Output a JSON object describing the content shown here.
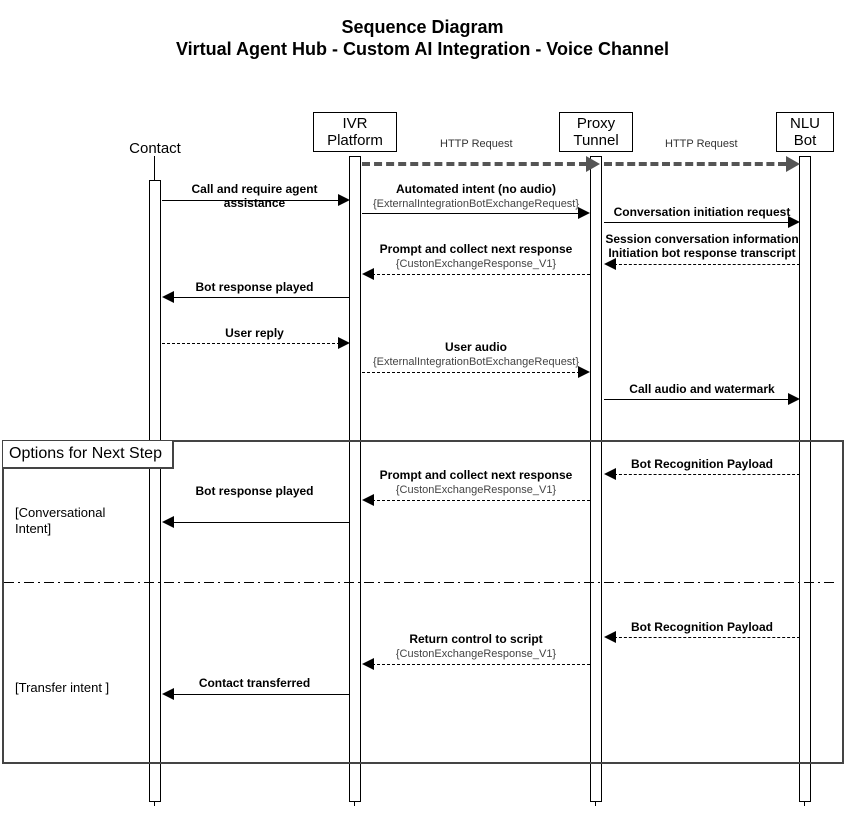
{
  "title_line1": "Sequence Diagram",
  "title_line2": "Virtual Agent Hub -  Custom AI Integration - Voice Channel",
  "actors": {
    "contact": "Contact",
    "ivr": "IVR\nPlatform",
    "proxy": "Proxy\nTunnel",
    "nlu": "NLU\nBot"
  },
  "labels": {
    "http": "HTTP Request",
    "options_title": "Options for Next Step",
    "conversational_intent": "[Conversational\nIntent]",
    "transfer_intent": "[Transfer intent ]"
  },
  "messages": {
    "m1": "Call and require agent assistance",
    "m2a": "Automated intent (no audio)",
    "m2b": "{ExternalIntegrationBotExchangeRequest}",
    "m3": "Conversation initiation request",
    "m4a": "Session conversation information",
    "m4b": "Initiation bot response transcript",
    "m5a": "Prompt and collect next response",
    "m5b": "{CustonExchangeResponse_V1}",
    "m6": "Bot response played",
    "m7": "User reply",
    "m8a": "User audio",
    "m8b": "{ExternalIntegrationBotExchangeRequest}",
    "m9": "Call audio and watermark",
    "m10": "Bot Recognition Payload",
    "m11a": "Prompt and collect next response",
    "m11b": "{CustonExchangeResponse_V1}",
    "m12": "Bot response played",
    "m13": "Bot Recognition Payload",
    "m14a": "Return control to script",
    "m14b": "{CustonExchangeResponse_V1}",
    "m15": "Contact transferred"
  }
}
